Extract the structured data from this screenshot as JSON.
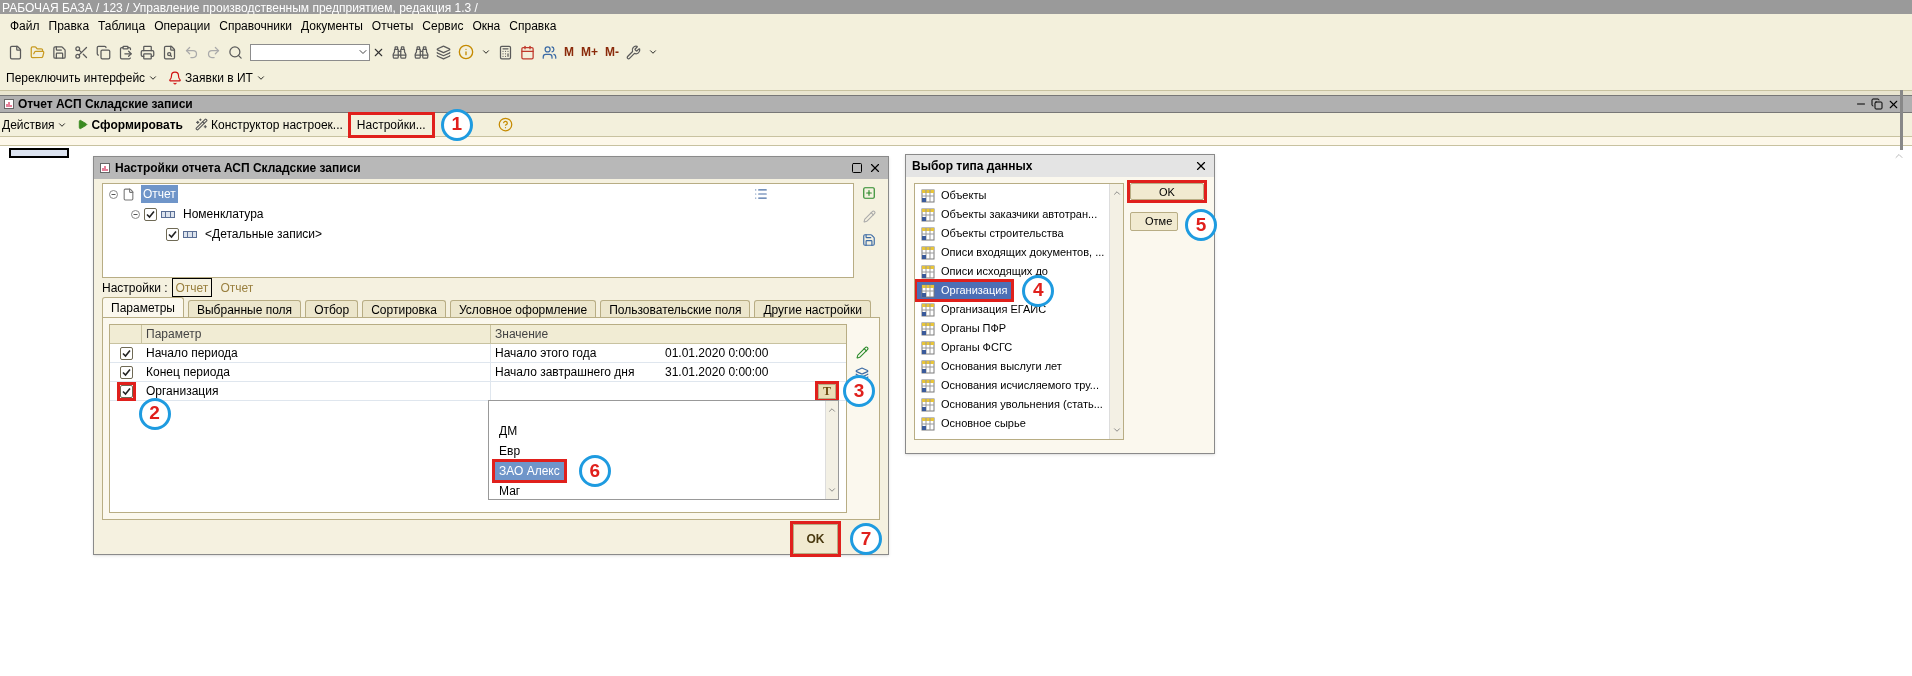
{
  "window": {
    "title": "РАБОЧАЯ БАЗА / 123 /  Управление производственным предприятием, редакция 1.3 /"
  },
  "menu": [
    "Файл",
    "Правка",
    "Таблица",
    "Операции",
    "Справочники",
    "Документы",
    "Отчеты",
    "Сервис",
    "Окна",
    "Справка"
  ],
  "memory_buttons": [
    "M",
    "M+",
    "M-"
  ],
  "interface_bar": [
    {
      "label": "Переключить интерфейс",
      "kind": "plain"
    },
    {
      "label": "Заявки в ИТ",
      "kind": "bell"
    }
  ],
  "report": {
    "title": "Отчет  АСП Складские записи",
    "actions": [
      {
        "label": "Действия",
        "kind": "menu"
      },
      {
        "label": "Сформировать",
        "kind": "run"
      },
      {
        "label": "Конструктор настроек...",
        "kind": "wizard"
      },
      {
        "label": "Настройки...",
        "kind": "plain"
      }
    ]
  },
  "settings_dialog": {
    "title": "Настройки отчета  АСП Складские записи",
    "tree": [
      {
        "label": "Отчет",
        "selected": true,
        "children": [
          {
            "label": "Номенклатура",
            "checked": true,
            "children": [
              {
                "label": "<Детальные записи>",
                "checked": true
              }
            ]
          }
        ]
      }
    ],
    "variants_label": "Настройки :",
    "variants": [
      {
        "label": "Отчет",
        "selected": true
      },
      {
        "label": "Отчет",
        "selected": false
      }
    ],
    "tabs": [
      {
        "label": "Параметры",
        "selected": true
      },
      {
        "label": "Выбранные поля",
        "selected": false
      },
      {
        "label": "Отбор",
        "selected": false
      },
      {
        "label": "Сортировка",
        "selected": false
      },
      {
        "label": "Условное оформление",
        "selected": false
      },
      {
        "label": "Пользовательские поля",
        "selected": false
      },
      {
        "label": "Другие настройки",
        "selected": false
      }
    ],
    "columns": [
      "Параметр",
      "Значение"
    ],
    "rows": [
      {
        "checked": true,
        "name": "Начало периода",
        "value": "Начало этого года",
        "date": "01.01.2020 0:00:00"
      },
      {
        "checked": true,
        "name": "Конец периода",
        "value": "Начало завтрашнего дня",
        "date": "31.01.2020 0:00:00"
      },
      {
        "checked": true,
        "name": "Организация",
        "type_button": "T"
      }
    ],
    "dropdown": [
      {
        "label": "ДМ",
        "selected": false
      },
      {
        "label": "Евр",
        "selected": false
      },
      {
        "label": "ЗАО Алекс",
        "selected": true
      },
      {
        "label": "Маг",
        "selected": false
      }
    ],
    "ok": "OK"
  },
  "type_dialog": {
    "title": "Выбор типа данных",
    "items": [
      {
        "label": "Объекты",
        "selected": false
      },
      {
        "label": "Объекты заказчики автотран...",
        "selected": false
      },
      {
        "label": "Объекты строительства",
        "selected": false
      },
      {
        "label": "Описи входящих документов, ...",
        "selected": false
      },
      {
        "label": "Описи исходящих до",
        "selected": false
      },
      {
        "label": "Организация",
        "selected": true
      },
      {
        "label": "Организация ЕГАИС",
        "selected": false
      },
      {
        "label": "Органы ПФР",
        "selected": false
      },
      {
        "label": "Органы ФСГС",
        "selected": false
      },
      {
        "label": "Основания выслуги лет",
        "selected": false
      },
      {
        "label": "Основания исчисляемого тру...",
        "selected": false
      },
      {
        "label": "Основания увольнения (стать...",
        "selected": false
      },
      {
        "label": "Основное сырье",
        "selected": false
      }
    ],
    "buttons": [
      "OK",
      "Отме"
    ]
  },
  "annotations": [
    "1",
    "2",
    "3",
    "4",
    "5",
    "6",
    "7"
  ]
}
